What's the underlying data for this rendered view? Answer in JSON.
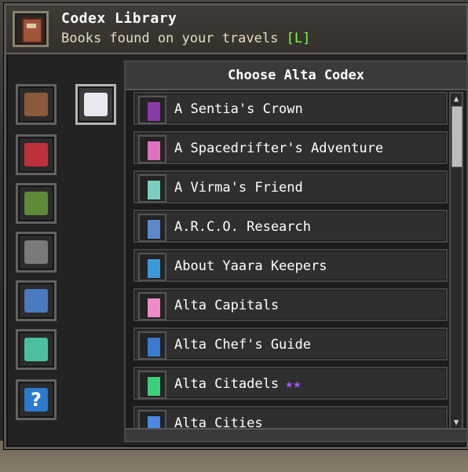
{
  "header": {
    "title": "Codex Library",
    "subtitle": "Books found on your travels",
    "hotkey": "[L]",
    "icon": "book-icon"
  },
  "panel": {
    "title": "Choose Alta Codex"
  },
  "categories": [
    {
      "name": "human-portrait-icon",
      "color": "#8a5a3a",
      "selected": false
    },
    {
      "name": "avian-bird-icon",
      "color": "#c0303a",
      "selected": false
    },
    {
      "name": "floran-plant-icon",
      "color": "#5f8a3a",
      "selected": false
    },
    {
      "name": "glitch-robot-icon",
      "color": "#7a7a7a",
      "selected": false
    },
    {
      "name": "hylotl-fish-icon",
      "color": "#4a7ac0",
      "selected": false
    },
    {
      "name": "novakid-star-icon",
      "color": "#4ac0a0",
      "selected": false
    },
    {
      "name": "unknown-question-icon",
      "color": "#2a7ad0",
      "selected": false
    },
    {
      "name": "alta-white-icon",
      "color": "#e8e8f0",
      "selected": true
    }
  ],
  "books": [
    {
      "label": "A Sentia's Crown",
      "icon_color": "#8a3aa8",
      "stars": ""
    },
    {
      "label": "A Spacedrifter's Adventure",
      "icon_color": "#e070c0",
      "stars": ""
    },
    {
      "label": "A Virma's Friend",
      "icon_color": "#7ad0c0",
      "stars": ""
    },
    {
      "label": "A.R.C.O. Research",
      "icon_color": "#5a8ac8",
      "stars": ""
    },
    {
      "label": "About Yaara Keepers",
      "icon_color": "#3a9ad8",
      "stars": ""
    },
    {
      "label": "Alta Capitals",
      "icon_color": "#f08ac8",
      "stars": ""
    },
    {
      "label": "Alta Chef's Guide",
      "icon_color": "#3a7ad0",
      "stars": ""
    },
    {
      "label": "Alta Citadels",
      "icon_color": "#3ad07a",
      "stars": "★★"
    },
    {
      "label": "Alta Cities",
      "icon_color": "#4a8ae0",
      "stars": ""
    }
  ]
}
